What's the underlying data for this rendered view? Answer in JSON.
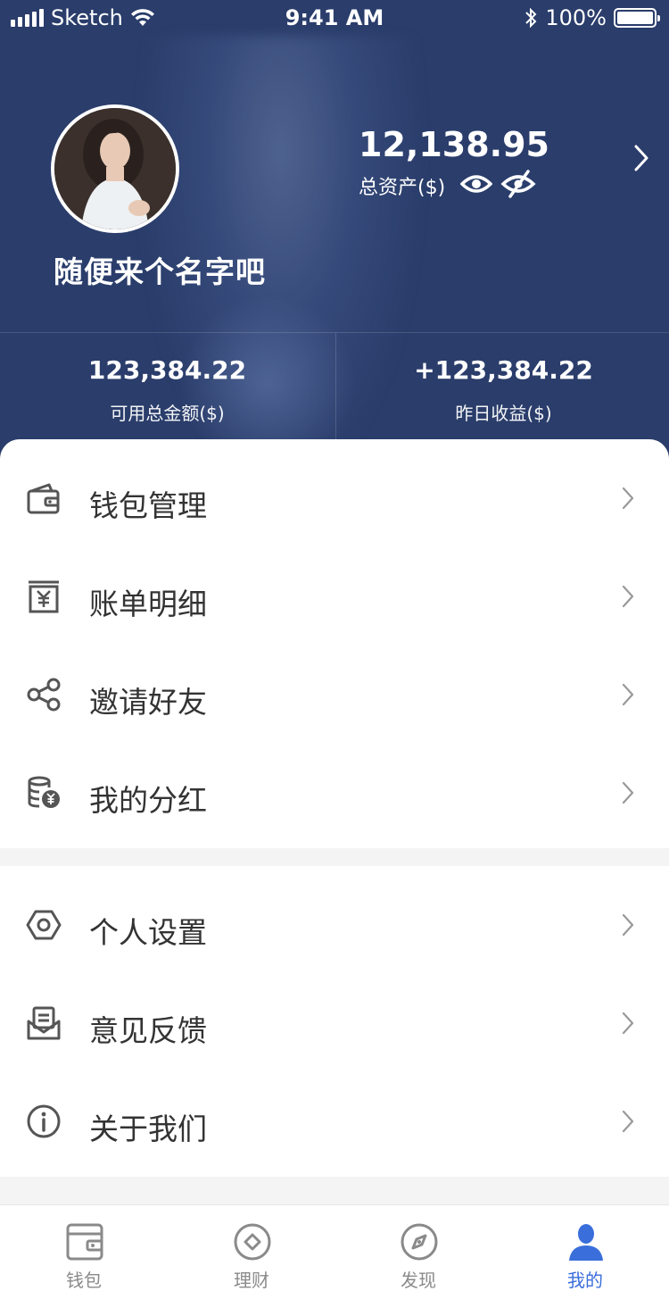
{
  "status_bar": {
    "carrier": "Sketch",
    "time": "9:41 AM",
    "battery": "100%"
  },
  "profile": {
    "username": "随便来个名字吧",
    "total_assets_value": "12,138.95",
    "total_assets_label": "总资产($)"
  },
  "stats": [
    {
      "value": "123,384.22",
      "label": "可用总金额($)"
    },
    {
      "value": "+123,384.22",
      "label": "昨日收益($)"
    }
  ],
  "menu_group_1": [
    {
      "label": "钱包管理",
      "icon": "wallet-icon"
    },
    {
      "label": "账单明细",
      "icon": "bill-icon"
    },
    {
      "label": "邀请好友",
      "icon": "share-icon"
    },
    {
      "label": "我的分红",
      "icon": "coins-icon"
    }
  ],
  "menu_group_2": [
    {
      "label": "个人设置",
      "icon": "settings-hexagon-icon"
    },
    {
      "label": "意见反馈",
      "icon": "feedback-icon"
    },
    {
      "label": "关于我们",
      "icon": "info-icon"
    }
  ],
  "tabbar": [
    {
      "label": "钱包",
      "icon": "wallet-icon",
      "active": false
    },
    {
      "label": "理财",
      "icon": "finance-icon",
      "active": false
    },
    {
      "label": "发现",
      "icon": "compass-icon",
      "active": false
    },
    {
      "label": "我的",
      "icon": "user-icon",
      "active": true
    }
  ],
  "colors": {
    "header_bg": "#2a3d6b",
    "accent": "#3a6edb",
    "icon_gray": "#555555",
    "text": "#333333"
  }
}
